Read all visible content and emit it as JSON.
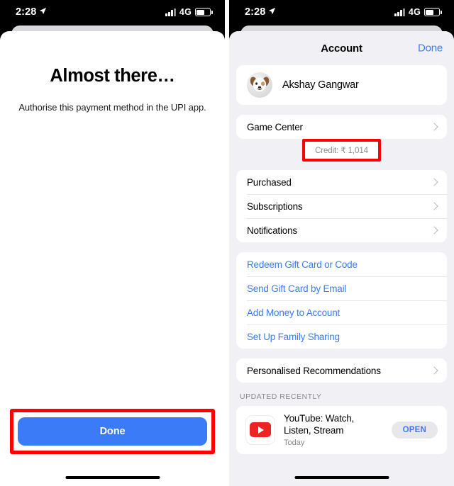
{
  "status_bar": {
    "time": "2:28",
    "location_icon": "location-arrow-icon",
    "network": "4G",
    "signal_icon": "signal-bars-icon",
    "battery_icon": "battery-icon"
  },
  "left_screen": {
    "title": "Almost there…",
    "subtitle": "Authorise this payment method in the UPI app.",
    "primary_button": "Done",
    "highlight_color": "#fd0000",
    "button_color": "#3b7bf7"
  },
  "right_screen": {
    "nav": {
      "title": "Account",
      "action": "Done"
    },
    "profile": {
      "name": "Akshay Gangwar",
      "avatar": "dog-memoji-avatar"
    },
    "game_center": {
      "label": "Game Center"
    },
    "credit": {
      "text": "Credit: ₹ 1,014",
      "highlight_color": "#fd0000"
    },
    "menu_items": [
      {
        "label": "Purchased"
      },
      {
        "label": "Subscriptions"
      },
      {
        "label": "Notifications"
      }
    ],
    "link_items": [
      {
        "label": "Redeem Gift Card or Code"
      },
      {
        "label": "Send Gift Card by Email"
      },
      {
        "label": "Add Money to Account"
      },
      {
        "label": "Set Up Family Sharing"
      }
    ],
    "recommendations": {
      "label": "Personalised Recommendations"
    },
    "updated_section": {
      "header": "UPDATED RECENTLY",
      "app": {
        "name": "YouTube: Watch, Listen, Stream",
        "subtitle": "Today",
        "action": "OPEN",
        "icon": "youtube-icon"
      }
    }
  }
}
